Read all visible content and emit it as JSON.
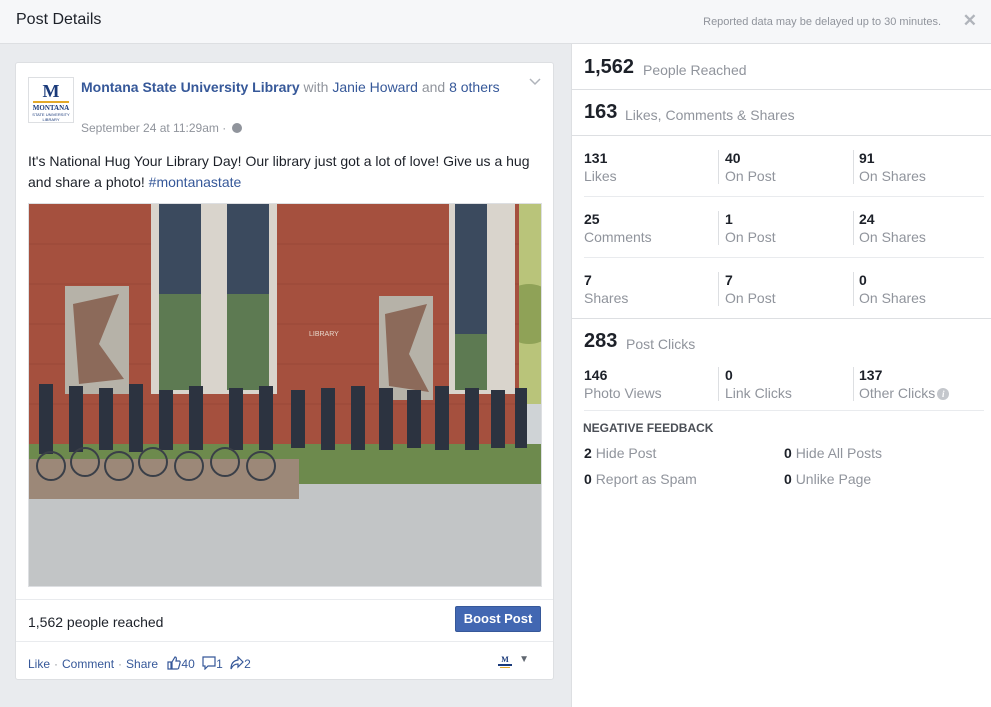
{
  "topbar": {
    "title": "Post Details",
    "note": "Reported data may be delayed up to 30 minutes.",
    "close": "✕"
  },
  "post": {
    "page_name": "Montana State University Library",
    "with_text": "with",
    "tagged_person": "Janie Howard",
    "and_text": "and",
    "others_link": "8 others",
    "date": "September 24 at 11:29am",
    "text": "It's National Hug Your Library Day! Our library just got a lot of love! Give us a hug and share a photo! ",
    "hashtag": "#montanastate",
    "logo": {
      "letter": "M",
      "line1": "MONTANA",
      "line2": "STATE UNIVERSITY",
      "line3": "LIBRARY"
    },
    "photo_label": "LIBRARY",
    "reached_text": "1,562 people reached",
    "boost_label": "Boost Post",
    "actions": {
      "like": "Like",
      "comment": "Comment",
      "share": "Share"
    },
    "counts": {
      "likes": "40",
      "comments": "1",
      "shares": "2"
    }
  },
  "stats": {
    "reached": {
      "value": "1,562",
      "label": "People Reached"
    },
    "engagement": {
      "value": "163",
      "label": "Likes, Comments & Shares"
    },
    "grid": [
      [
        {
          "value": "131",
          "label": "Likes"
        },
        {
          "value": "40",
          "label": "On Post"
        },
        {
          "value": "91",
          "label": "On Shares"
        }
      ],
      [
        {
          "value": "25",
          "label": "Comments"
        },
        {
          "value": "1",
          "label": "On Post"
        },
        {
          "value": "24",
          "label": "On Shares"
        }
      ],
      [
        {
          "value": "7",
          "label": "Shares"
        },
        {
          "value": "7",
          "label": "On Post"
        },
        {
          "value": "0",
          "label": "On Shares"
        }
      ]
    ],
    "clicks": {
      "value": "283",
      "label": "Post Clicks"
    },
    "click_breakdown": [
      {
        "value": "146",
        "label": "Photo Views"
      },
      {
        "value": "0",
        "label": "Link Clicks"
      },
      {
        "value": "137",
        "label": "Other Clicks"
      }
    ],
    "negative": {
      "title": "NEGATIVE FEEDBACK",
      "items": [
        {
          "value": "2",
          "label": "Hide Post"
        },
        {
          "value": "0",
          "label": "Hide All Posts"
        },
        {
          "value": "0",
          "label": "Report as Spam"
        },
        {
          "value": "0",
          "label": "Unlike Page"
        }
      ]
    }
  },
  "colors": {
    "link": "#365899",
    "button": "#4267b2",
    "muted": "#90949c",
    "panel_bg": "#e9ebee"
  }
}
